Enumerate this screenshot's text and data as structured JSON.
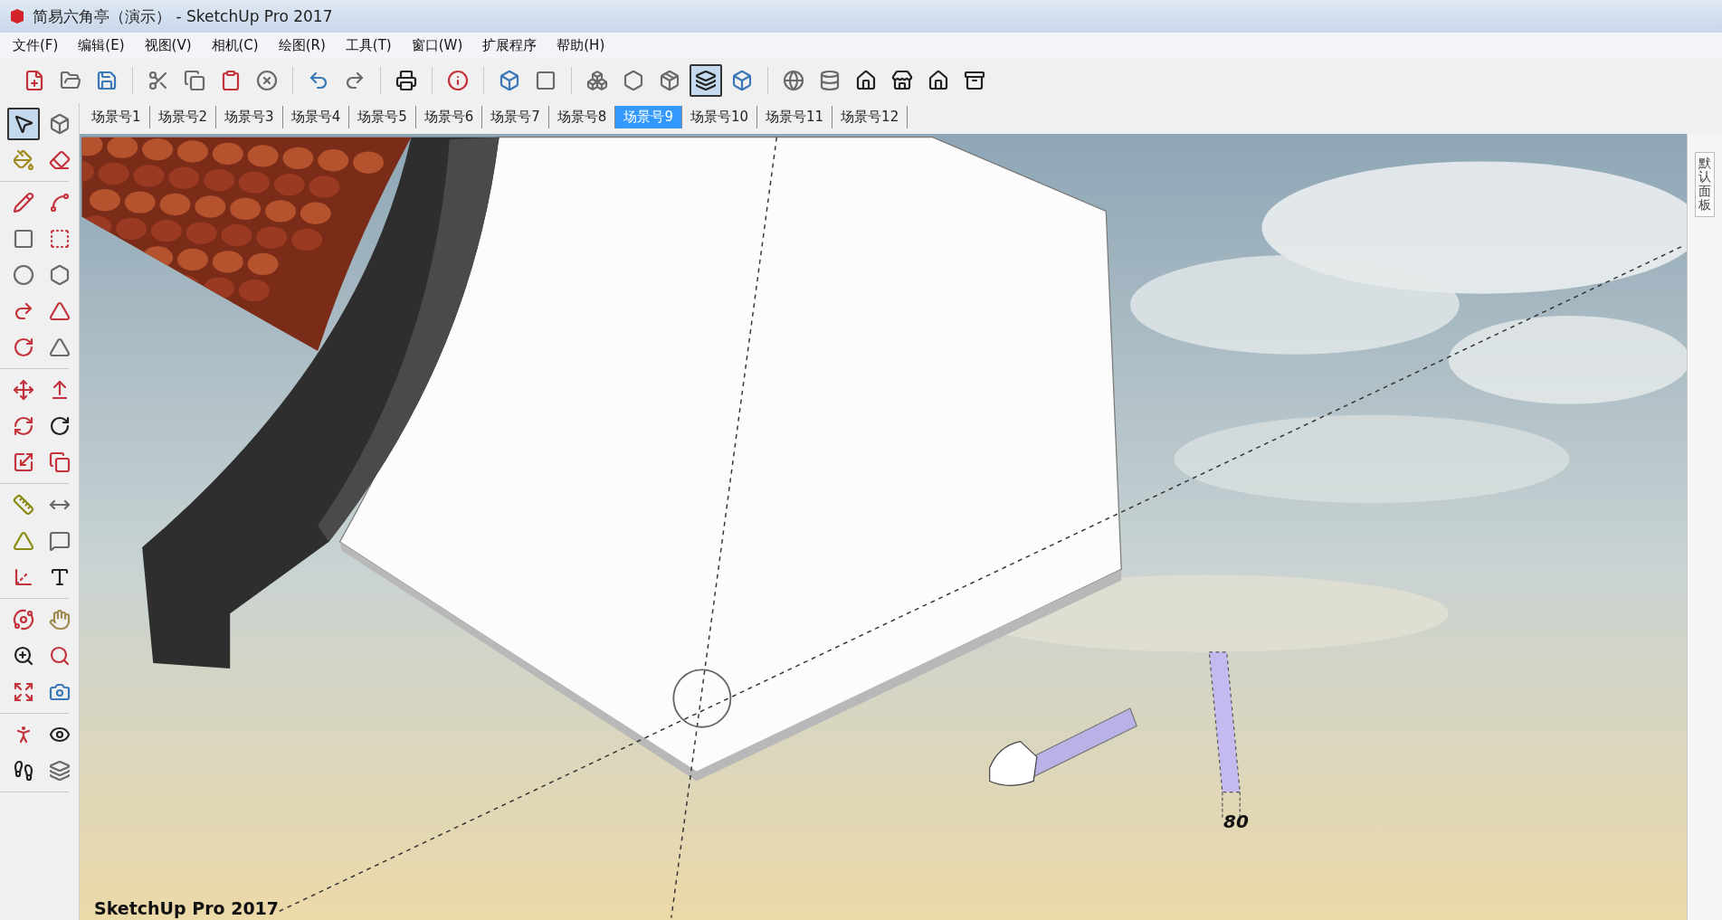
{
  "window": {
    "title": "简易六角亭（演示） - SketchUp Pro 2017"
  },
  "menu": [
    "文件(F)",
    "编辑(E)",
    "视图(V)",
    "相机(C)",
    "绘图(R)",
    "工具(T)",
    "窗口(W)",
    "扩展程序",
    "帮助(H)"
  ],
  "toolbar": [
    {
      "selected": false
    },
    {
      "selected": false
    },
    {
      "selected": false
    },
    {
      "selected": false
    },
    {
      "selected": false
    },
    {
      "selected": false
    },
    {
      "selected": false
    },
    {
      "selected": false
    },
    {
      "selected": false
    },
    {
      "selected": false
    },
    {
      "selected": false
    },
    {
      "selected": false
    },
    {
      "selected": false
    },
    {
      "selected": false
    },
    {
      "selected": false
    },
    {
      "selected": false
    },
    {
      "selected": true
    },
    {
      "selected": false
    },
    {
      "selected": false
    },
    {
      "selected": false
    },
    {
      "selected": false
    },
    {
      "selected": false
    },
    {
      "selected": false
    },
    {
      "selected": false
    }
  ],
  "scenes": [
    {
      "label": "场景号1",
      "selected": false
    },
    {
      "label": "场景号2",
      "selected": false
    },
    {
      "label": "场景号3",
      "selected": false
    },
    {
      "label": "场景号4",
      "selected": false
    },
    {
      "label": "场景号5",
      "selected": false
    },
    {
      "label": "场景号6",
      "selected": false
    },
    {
      "label": "场景号7",
      "selected": false
    },
    {
      "label": "场景号8",
      "selected": false
    },
    {
      "label": "场景号9",
      "selected": true
    },
    {
      "label": "场景号10",
      "selected": false
    },
    {
      "label": "场景号11",
      "selected": false
    },
    {
      "label": "场景号12",
      "selected": false
    }
  ],
  "tools": [
    {
      "selected": true
    },
    {
      "selected": false
    },
    {
      "selected": false
    },
    {
      "selected": false
    },
    {
      "selected": false
    },
    {
      "selected": false
    },
    {
      "selected": false
    },
    {
      "selected": false
    },
    {
      "selected": false
    },
    {
      "selected": false
    },
    {
      "selected": false
    },
    {
      "selected": false
    },
    {
      "selected": false
    },
    {
      "selected": false
    },
    {
      "selected": false
    },
    {
      "selected": false
    },
    {
      "selected": false
    },
    {
      "selected": false
    },
    {
      "selected": false
    },
    {
      "selected": false
    },
    {
      "selected": false
    },
    {
      "selected": false
    },
    {
      "selected": false
    },
    {
      "selected": false
    },
    {
      "selected": false
    },
    {
      "selected": false
    },
    {
      "selected": false
    },
    {
      "selected": false
    },
    {
      "selected": false
    },
    {
      "selected": false
    },
    {
      "selected": false
    },
    {
      "selected": false
    },
    {
      "selected": false
    },
    {
      "selected": false
    },
    {
      "selected": false
    },
    {
      "selected": false
    }
  ],
  "viewport": {
    "dimension": "80",
    "caption": "SketchUp Pro 2017"
  },
  "tray": {
    "label": "默认面板"
  }
}
